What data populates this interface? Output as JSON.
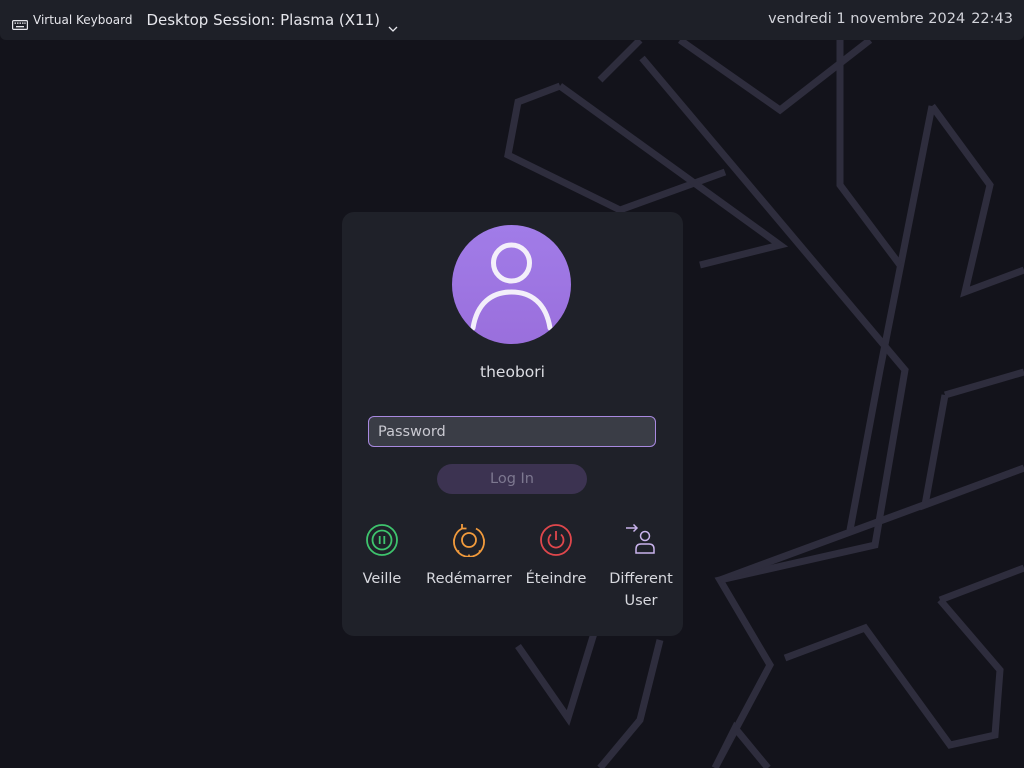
{
  "topbar": {
    "virtual_keyboard_label": "Virtual Keyboard",
    "session_label": "Desktop Session: Plasma (X11)",
    "date": "vendredi 1 novembre 2024",
    "time": "22:43"
  },
  "login": {
    "username": "theobori",
    "password_placeholder": "Password",
    "password_value": "",
    "login_button": "Log In"
  },
  "actions": [
    {
      "label": "Veille",
      "icon": "sleep-icon",
      "color": "#3ec46d"
    },
    {
      "label": "Redémarrer",
      "icon": "restart-icon",
      "color": "#f29b3c"
    },
    {
      "label": "Éteindre",
      "icon": "power-icon",
      "color": "#e0474c"
    },
    {
      "label": "Different User",
      "icon": "switch-user-icon",
      "color": "#b89be0"
    }
  ],
  "colors": {
    "background": "#13131b",
    "topbar": "#1e2028",
    "card": "#1f2129",
    "accent": "#a889e0",
    "avatar": "#a17ce8",
    "wallpaper_stroke": "#2e2d3d"
  }
}
